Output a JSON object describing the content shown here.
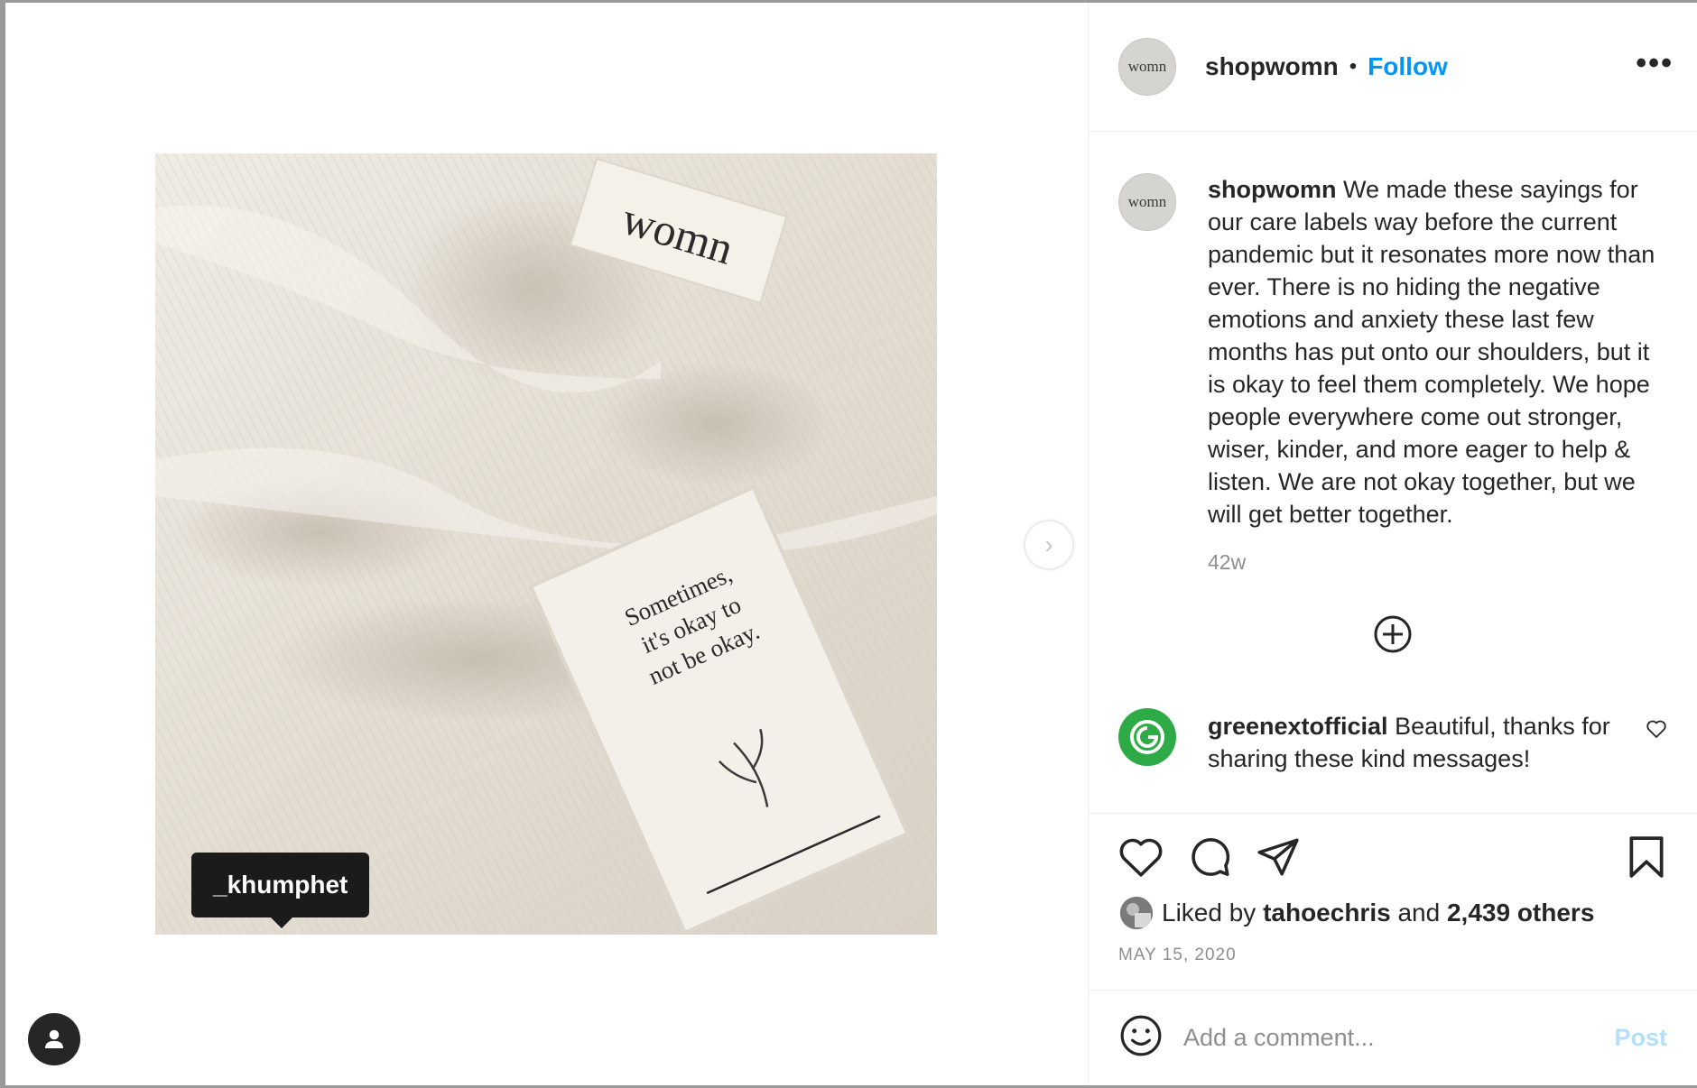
{
  "post": {
    "author": {
      "username": "shopwomn",
      "avatar_text": "womn",
      "follow_label": "Follow",
      "separator": "•"
    },
    "more_options_label": "•••",
    "caption": {
      "username": "shopwomn",
      "text": "We made these sayings for our care labels way before the current pandemic but it resonates more now than ever. There is no hiding the negative emotions and anxiety these last few months has put onto our shoulders, but it is okay to feel them completely. We hope people everywhere come out stronger, wiser, kinder, and more eager to help & listen. We are not okay together, but we will get better together."
    },
    "relative_time": "42w",
    "comments": [
      {
        "username": "greenextofficial",
        "text": "Beautiful, thanks for sharing these kind messages!"
      }
    ],
    "likes": {
      "prefix": "Liked by",
      "first_liker": "tahoechris",
      "conjunction": "and",
      "others": "2,439 others"
    },
    "date": "MAY 15, 2020",
    "comment_box": {
      "placeholder": "Add a comment...",
      "post_label": "Post"
    }
  },
  "media": {
    "tag_label": "_khumphet",
    "label_brand": "womn",
    "label_saying": [
      "Sometimes,",
      "it's okay to",
      "not be okay."
    ],
    "next_arrow": "›"
  },
  "colors": {
    "accent": "#0095f6",
    "post_disabled": "#b2dffc",
    "muted": "#8e8e8e",
    "text": "#262626",
    "comment_avatar": "#2eab46"
  },
  "icons": {
    "actions": [
      "heart-icon",
      "comment-icon",
      "share-icon",
      "bookmark-icon"
    ],
    "other": [
      "emoji-icon",
      "plus-circle-icon",
      "user-tag-icon",
      "chevron-right-icon"
    ]
  }
}
